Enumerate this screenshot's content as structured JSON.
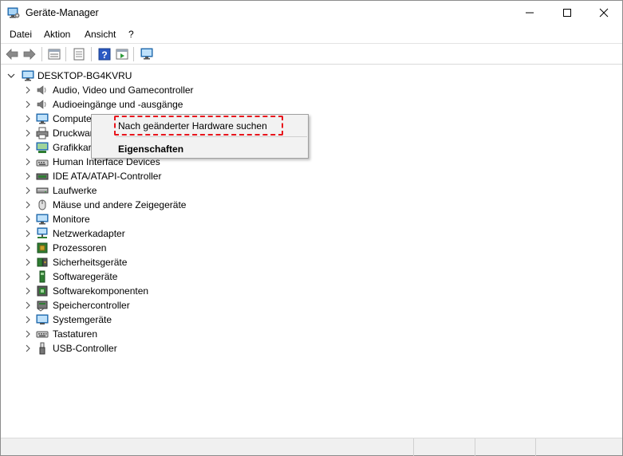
{
  "window": {
    "title": "Geräte-Manager",
    "minimize_icon": "minimize-icon",
    "maximize_icon": "maximize-icon",
    "close_icon": "close-icon"
  },
  "menubar": {
    "items": [
      {
        "label": "Datei"
      },
      {
        "label": "Aktion"
      },
      {
        "label": "Ansicht"
      },
      {
        "label": "?"
      }
    ]
  },
  "toolbar": {
    "buttons": [
      "back-icon",
      "forward-icon",
      "properties-view-icon",
      "details-icon",
      "help-icon",
      "run-icon",
      "computer-scan-icon"
    ]
  },
  "tree": {
    "root": {
      "label": "DESKTOP-BG4KVRU",
      "expanded": true
    },
    "items": [
      {
        "label": "Audio, Video und Gamecontroller",
        "icon": "speaker-icon"
      },
      {
        "label": "Audioeingänge und -ausgänge",
        "icon": "speaker-icon"
      },
      {
        "label": "Computer",
        "icon": "monitor-icon"
      },
      {
        "label": "Druckwarteschlangen",
        "icon": "printer-icon"
      },
      {
        "label": "Grafikkarten",
        "icon": "display-adapter-icon"
      },
      {
        "label": "Human Interface Devices",
        "icon": "hid-icon"
      },
      {
        "label": "IDE ATA/ATAPI-Controller",
        "icon": "ide-icon"
      },
      {
        "label": "Laufwerke",
        "icon": "drive-icon"
      },
      {
        "label": "Mäuse und andere Zeigegeräte",
        "icon": "mouse-icon"
      },
      {
        "label": "Monitore",
        "icon": "monitor-icon"
      },
      {
        "label": "Netzwerkadapter",
        "icon": "network-icon"
      },
      {
        "label": "Prozessoren",
        "icon": "processor-icon"
      },
      {
        "label": "Sicherheitsgeräte",
        "icon": "security-icon"
      },
      {
        "label": "Softwaregeräte",
        "icon": "software-device-icon"
      },
      {
        "label": "Softwarekomponenten",
        "icon": "software-component-icon"
      },
      {
        "label": "Speichercontroller",
        "icon": "storage-icon"
      },
      {
        "label": "Systemgeräte",
        "icon": "system-icon"
      },
      {
        "label": "Tastaturen",
        "icon": "keyboard-icon"
      },
      {
        "label": "USB-Controller",
        "icon": "usb-icon"
      }
    ]
  },
  "context_menu": {
    "scan_label": "Nach geänderter Hardware suchen",
    "properties_label": "Eigenschaften",
    "highlight_color": "#e8151c"
  },
  "colors": {
    "accent": "#1a73c9",
    "highlight": "#e8151c"
  }
}
